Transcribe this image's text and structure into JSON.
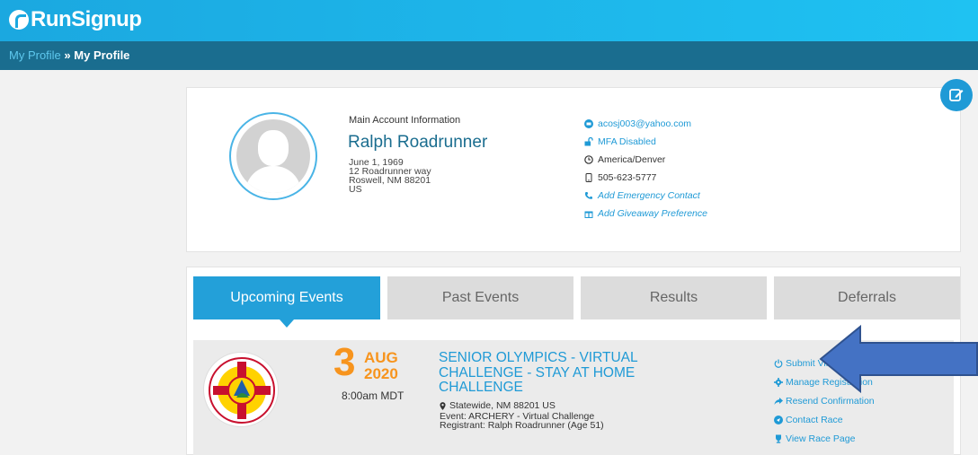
{
  "brand": {
    "name": "RunSignup"
  },
  "breadcrumb": {
    "link": "My Profile",
    "separator": "»",
    "current": "My Profile"
  },
  "profile": {
    "section_label": "Main Account Information",
    "name": "Ralph Roadrunner",
    "birthdate": "June 1, 1969",
    "address1": "12 Roadrunner way",
    "address2": "Roswell, NM 88201",
    "country": "US",
    "email": "acosj003@yahoo.com",
    "mfa": "MFA Disabled",
    "timezone": "America/Denver",
    "phone": "505-623-5777",
    "emergency": "Add Emergency Contact",
    "giveaway": "Add Giveaway Preference"
  },
  "tabs": [
    {
      "label": "Upcoming Events",
      "active": true
    },
    {
      "label": "Past Events",
      "active": false
    },
    {
      "label": "Results",
      "active": false
    },
    {
      "label": "Deferrals",
      "active": false
    }
  ],
  "event": {
    "day": "3",
    "month": "AUG",
    "year": "2020",
    "time": "8:00am MDT",
    "title": "SENIOR OLYMPICS - VIRTUAL CHALLENGE - STAY AT HOME CHALLENGE",
    "location": "Statewide, NM 88201 US",
    "event_line": "Event: ARCHERY - Virtual Challenge",
    "registrant": "Registrant: Ralph Roadrunner (Age 51)",
    "actions": [
      "Submit Virtual Results",
      "Manage Registration",
      "Resend Confirmation",
      "Contact Race",
      "View Race Page"
    ]
  },
  "colors": {
    "header": "#1ba8e0",
    "breadcrumb_bar": "#1a6d8f",
    "accent": "#1f9ad6",
    "date": "#f7941d",
    "annotation_arrow": "#4472c4"
  }
}
